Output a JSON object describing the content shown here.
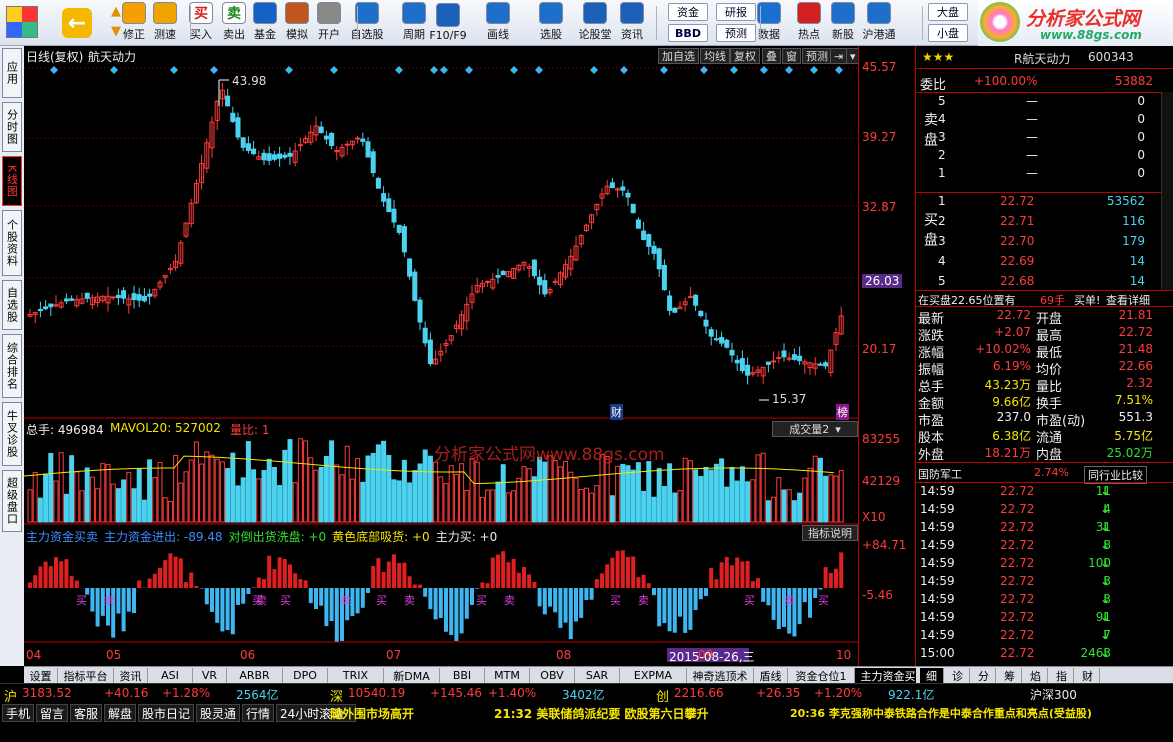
{
  "toolbar": {
    "items": [
      {
        "label": "修正",
        "icon": "back-arrow-icon"
      },
      {
        "label": "测速",
        "icon": "clock-icon"
      },
      {
        "label": "买入",
        "icon": "buy-icon",
        "glyph": "买",
        "color": "#d81e1e"
      },
      {
        "label": "卖出",
        "icon": "sell-icon",
        "glyph": "卖",
        "color": "#1e8a1e"
      },
      {
        "label": "基金",
        "icon": "fund-icon"
      },
      {
        "label": "模拟",
        "icon": "hammer-icon"
      },
      {
        "label": "开户",
        "icon": "lock-icon"
      },
      {
        "label": "自选股",
        "icon": "star-folder-icon"
      },
      {
        "label": "周期",
        "icon": "period-icon"
      },
      {
        "label": "F10/F9",
        "icon": "f10-icon"
      },
      {
        "label": "画线",
        "icon": "pen-icon"
      },
      {
        "label": "选股",
        "icon": "select-icon"
      },
      {
        "label": "论股堂",
        "icon": "forum-icon"
      },
      {
        "label": "资讯",
        "icon": "news-icon"
      },
      {
        "label": "数据",
        "icon": "data-icon"
      },
      {
        "label": "热点",
        "icon": "hot-icon"
      },
      {
        "label": "新股",
        "icon": "newstock-icon"
      },
      {
        "label": "沪港通",
        "icon": "hk-icon"
      }
    ],
    "small_buttons": {
      "zijin": "资金",
      "bbd": "BBD",
      "yanbao": "研报",
      "yuce": "预测",
      "dapan": "大盘",
      "xiaopan": "小盘"
    },
    "brand": "分析家公式网",
    "brand_url": "www.88gs.com"
  },
  "sidebar": [
    "应用",
    "分时图",
    "K线图",
    "个股资料",
    "自选股",
    "综合排名",
    "牛叉诊股",
    "超级盘口"
  ],
  "chart": {
    "title": "日线(复权)",
    "stock": "航天动力",
    "buttons": [
      "加自选",
      "均线",
      "复权",
      "叠",
      "窗",
      "预测"
    ],
    "price_axis": [
      "45.57",
      "39.27",
      "32.87",
      "26.03",
      "20.17"
    ],
    "cursor_price": "26.03",
    "high_label": "43.98",
    "low_label": "15.37",
    "events": [
      "财",
      "榜"
    ],
    "date_axis": [
      "04",
      "05",
      "06",
      "07",
      "08",
      "09",
      "10"
    ],
    "cursor_date": "2015-08-26,三",
    "watermark": "分析家公式网www.88gs.com"
  },
  "volume": {
    "total_label": "总手: 496984",
    "ma_label": "MAVOL20: 527002",
    "ratio_label": "量比: 1",
    "select": "成交量2",
    "axis": [
      "83255",
      "42129",
      "X10"
    ]
  },
  "indicator": {
    "labels": [
      "主力资金买卖",
      "主力资金进出: -89.48",
      "对倒出货洗盘: +0",
      "黄色底部吸货: +0",
      "主力买: +0"
    ],
    "btn": "指标说明",
    "axis": [
      "+84.71",
      "-5.46"
    ],
    "buy_text": "买",
    "sell_text": "卖"
  },
  "quote": {
    "stars": "★★★",
    "name": "R航天动力",
    "code": "600343",
    "weibi": {
      "label": "委比",
      "pct": "+100.00%",
      "val": "53882"
    },
    "sell_side": "卖盘",
    "buy_side": "买盘",
    "sell": [
      [
        "5",
        "—",
        "0"
      ],
      [
        "4",
        "—",
        "0"
      ],
      [
        "3",
        "—",
        "0"
      ],
      [
        "2",
        "—",
        "0"
      ],
      [
        "1",
        "—",
        "0"
      ]
    ],
    "buy": [
      [
        "1",
        "22.72",
        "53562"
      ],
      [
        "2",
        "22.71",
        "116"
      ],
      [
        "3",
        "22.70",
        "179"
      ],
      [
        "4",
        "22.69",
        "14"
      ],
      [
        "5",
        "22.68",
        "14"
      ]
    ],
    "notice": "在买盘22.65位置有",
    "notice_num": "69手",
    "notice_action": "买单!",
    "notice_link": "查看详细",
    "stats": [
      [
        "最新",
        "22.72",
        "开盘",
        "21.81"
      ],
      [
        "涨跌",
        "+2.07",
        "最高",
        "22.72"
      ],
      [
        "涨幅",
        "+10.02%",
        "最低",
        "21.48"
      ],
      [
        "振幅",
        "6.19%",
        "均价",
        "22.66"
      ],
      [
        "总手",
        "43.23万",
        "量比",
        "2.32"
      ],
      [
        "金额",
        "9.66亿",
        "换手",
        "7.51%"
      ],
      [
        "市盈",
        "237.0",
        "市盈(动)",
        "551.3"
      ],
      [
        "股本",
        "6.38亿",
        "流通",
        "5.75亿"
      ],
      [
        "外盘",
        "18.21万",
        "内盘",
        "25.02万"
      ]
    ],
    "sector": "国防军工",
    "sector_pct": "2.74%",
    "sector_btn": "同行业比较",
    "ticks": [
      [
        "14:59",
        "22.72",
        "11"
      ],
      [
        "14:59",
        "22.72",
        "4"
      ],
      [
        "14:59",
        "22.72",
        "31"
      ],
      [
        "14:59",
        "22.72",
        "8"
      ],
      [
        "14:59",
        "22.72",
        "100"
      ],
      [
        "14:59",
        "22.72",
        "3"
      ],
      [
        "14:59",
        "22.72",
        "3"
      ],
      [
        "14:59",
        "22.72",
        "91"
      ],
      [
        "14:59",
        "22.72",
        "7"
      ],
      [
        "15:00",
        "22.72",
        "2463"
      ]
    ],
    "tabs": [
      "细",
      "诊",
      "分",
      "筹",
      "焰",
      "指",
      "财"
    ]
  },
  "bottomtabs": [
    "设置",
    "指标平台",
    "资讯",
    "ASI",
    "VR",
    "ARBR",
    "DPO",
    "TRIX",
    "新DMA",
    "BBI",
    "MTM",
    "OBV",
    "SAR",
    "EXPMA",
    "神奇逃顶术",
    "盾线",
    "资金仓位1",
    "主力资金买卖"
  ],
  "ticker": {
    "sh": {
      "name": "沪",
      "val": "3183.52",
      "chg": "+40.16",
      "pct": "+1.28%",
      "amt": "2564亿"
    },
    "sz": {
      "name": "深",
      "val": "10540.19",
      "chg": "+145.46",
      "pct": "+1.40%",
      "amt": "3402亿"
    },
    "cy": {
      "name": "创",
      "val": "2216.66",
      "chg": "+26.35",
      "pct": "+1.20%",
      "amt": "922.1亿"
    },
    "hs": "沪深300"
  },
  "statusbar": {
    "buttons": [
      "手机",
      "留言",
      "客服",
      "解盘",
      "股市日记",
      "股灵通",
      "行情",
      "24小时滚动"
    ],
    "news": [
      "随外围市场高开",
      "21:32 美联储鸽派纪要  欧股第六日攀升",
      "20:36 李克强称中泰铁路合作是中泰合作重点和亮点(受益股)"
    ]
  }
}
